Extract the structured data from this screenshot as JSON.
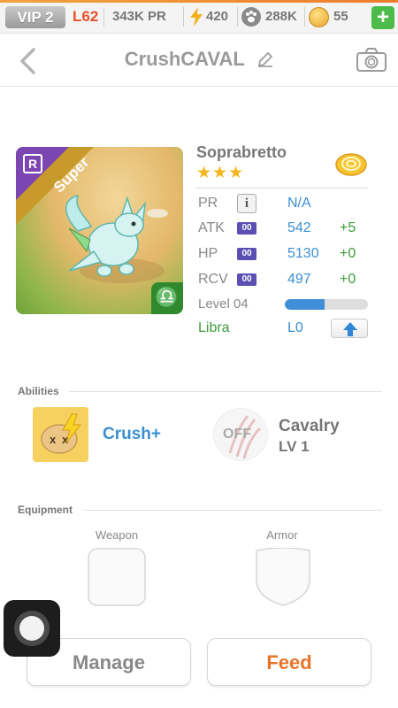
{
  "top_bar": {
    "vip": "VIP 2",
    "level": "L62",
    "pr": "343K PR",
    "energy": "420",
    "paws": "288K",
    "coins": "55",
    "plus": "+",
    "icons": {
      "energy": "lightning-icon",
      "paws": "paw-icon",
      "coins": "coin-icon",
      "add": "plus-icon"
    }
  },
  "header": {
    "title": "CrushCAVAL",
    "icons": [
      "back-chevron-icon",
      "pencil-icon",
      "camera-icon"
    ]
  },
  "dragon": {
    "name": "Soprabretto",
    "stars": "★★★",
    "rarity": "Super",
    "rarity_badge": "R",
    "zodiac_symbol": "♎",
    "stats": [
      {
        "label": "PR",
        "value": "N/A",
        "bonus": ""
      },
      {
        "label": "ATK",
        "tag": "00",
        "value": "542",
        "bonus": "+5"
      },
      {
        "label": "HP",
        "tag": "00",
        "value": "5130",
        "bonus": "+0"
      },
      {
        "label": "RCV",
        "tag": "00",
        "value": "497",
        "bonus": "+0"
      }
    ],
    "info_glyph": "i",
    "level_text": "Level 04",
    "level_progress": 0.48,
    "sign": "Libra",
    "sign_level": "L0"
  },
  "abilities": {
    "title": "Abilities",
    "primary": "Crush+",
    "off_label": "OFF",
    "skill_name": "Cavalry",
    "skill_level": "LV 1"
  },
  "equipment": {
    "title": "Equipment",
    "weapon": "Weapon",
    "armor": "Armor"
  },
  "buttons": {
    "manage": "Manage",
    "feed": "Feed"
  },
  "colors": {
    "accent_orange": "#e8742a",
    "blue": "#3b8fd2",
    "green": "#3c9b3c",
    "purple": "#5b4fb3"
  }
}
